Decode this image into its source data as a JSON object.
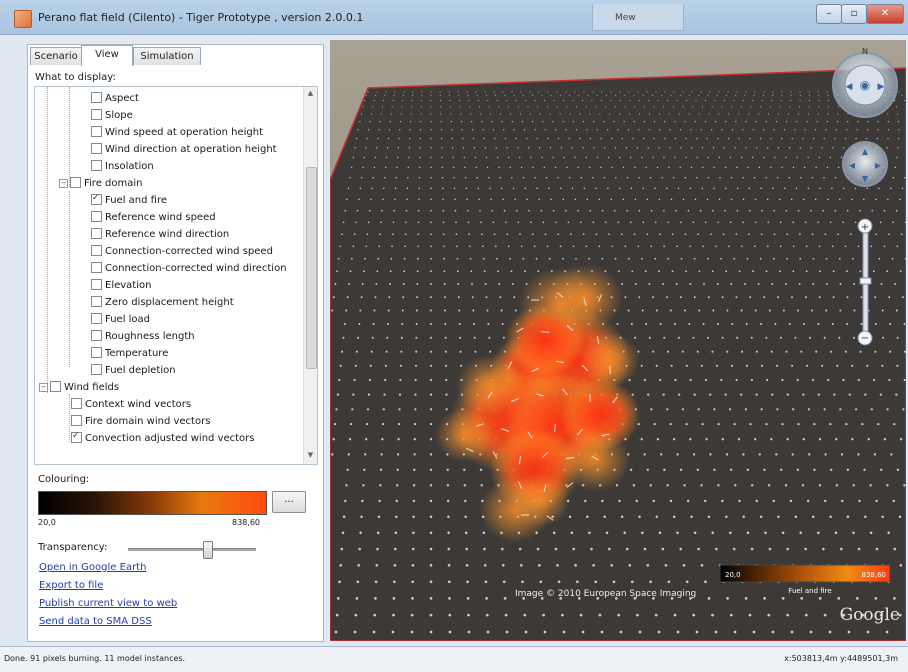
{
  "window": {
    "title": "Perano flat field (Cilento) - Tiger Prototype , version 2.0.0.1",
    "taskbar_tab": "Mew",
    "min_glyph": "–",
    "max_glyph": "▫",
    "close_glyph": "✕"
  },
  "tabs": [
    {
      "label": "Scenario"
    },
    {
      "label": "View",
      "active": true
    },
    {
      "label": "Simulation"
    }
  ],
  "display_group_label": "What to display:",
  "tree": {
    "items": [
      {
        "label": "Aspect",
        "checked": false
      },
      {
        "label": "Slope",
        "checked": false
      },
      {
        "label": "Wind speed at operation height",
        "checked": false
      },
      {
        "label": "Wind direction at operation height",
        "checked": false
      },
      {
        "label": "Insolation",
        "checked": false
      },
      {
        "label": "Fire domain",
        "checked": false,
        "expander": "−"
      },
      {
        "label": "Fuel and fire",
        "checked": true
      },
      {
        "label": "Reference wind speed",
        "checked": false
      },
      {
        "label": "Reference wind direction",
        "checked": false
      },
      {
        "label": "Connection-corrected wind speed",
        "checked": false
      },
      {
        "label": "Connection-corrected wind direction",
        "checked": false
      },
      {
        "label": "Elevation",
        "checked": false
      },
      {
        "label": "Zero displacement height",
        "checked": false
      },
      {
        "label": "Fuel load",
        "checked": false
      },
      {
        "label": "Roughness length",
        "checked": false
      },
      {
        "label": "Temperature",
        "checked": false
      },
      {
        "label": "Fuel depletion",
        "checked": false
      },
      {
        "label": "Wind fields",
        "checked": false,
        "expander": "−"
      },
      {
        "label": "Context wind vectors",
        "checked": false
      },
      {
        "label": "Fire domain wind vectors",
        "checked": false
      },
      {
        "label": "Convection adjusted wind vectors",
        "checked": true
      }
    ]
  },
  "colouring": {
    "label": "Colouring:",
    "min": "20,0",
    "max": "838,60",
    "button": "..."
  },
  "transparency": {
    "label": "Transparency:",
    "level": 0.62
  },
  "links": [
    "Open in Google Earth",
    "Export to file",
    "Publish current view to web",
    "Send data to SMA DSS"
  ],
  "map": {
    "credit": "Image © 2010 European Space Imaging",
    "logo": "Google",
    "legend": {
      "min": "20,0",
      "max": "838,60",
      "label": "Fuel and fire"
    },
    "colors": {
      "grid_dot": "#e6e6e6",
      "ground": "#3b3835",
      "fire_core": "#ff3a1a",
      "fire_edge": "#ff9b2e",
      "border": "#c83030"
    }
  },
  "status": {
    "left": "Done. 91 pixels burning. 11 model instances.",
    "right": "x:503813,4m  y:4489501,3m"
  }
}
